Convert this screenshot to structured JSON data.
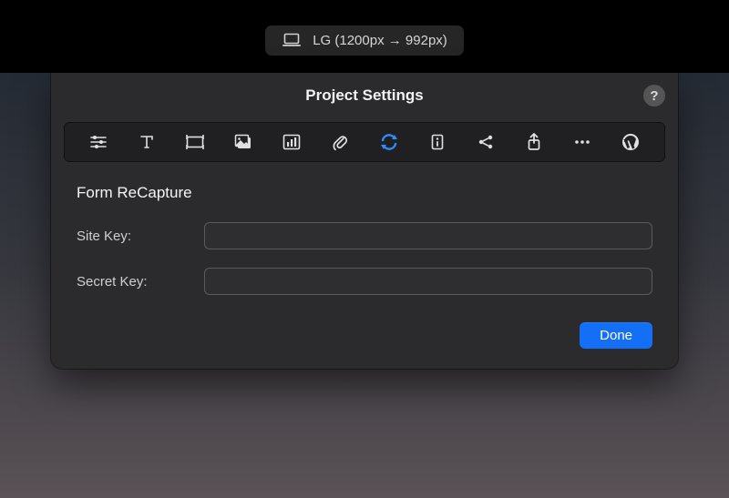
{
  "topbar": {
    "breakpoint_label": "LG (1200px → 992px)"
  },
  "sheet": {
    "title": "Project Settings",
    "help_glyph": "?",
    "tabs": [
      {
        "name": "general"
      },
      {
        "name": "typography"
      },
      {
        "name": "frame"
      },
      {
        "name": "image"
      },
      {
        "name": "analytics"
      },
      {
        "name": "attachments"
      },
      {
        "name": "recapture",
        "active": true
      },
      {
        "name": "info"
      },
      {
        "name": "share"
      },
      {
        "name": "export"
      },
      {
        "name": "more"
      },
      {
        "name": "wordpress"
      }
    ],
    "section_title": "Form ReCapture",
    "fields": {
      "site_key": {
        "label": "Site Key:",
        "value": ""
      },
      "secret_key": {
        "label": "Secret Key:",
        "value": ""
      }
    },
    "done_label": "Done"
  }
}
